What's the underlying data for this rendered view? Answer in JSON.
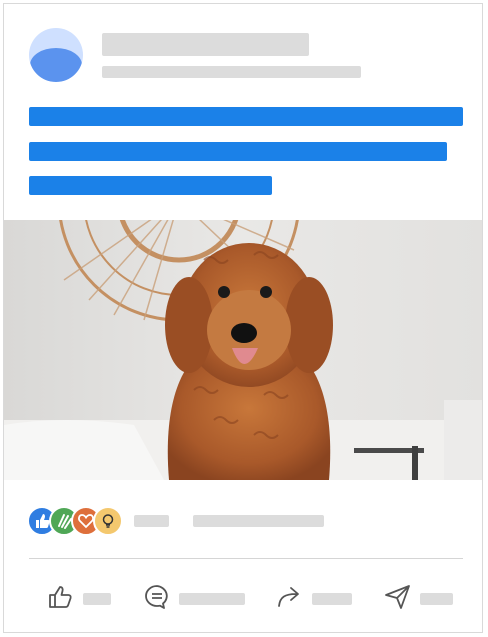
{
  "post": {
    "avatar_colors": {
      "bg": "#cfe0ff",
      "fg": "#5b93ee"
    },
    "skeleton_color": "#dcdcdc",
    "text_skeleton_color": "#1b81e8",
    "image_subject": "dog-photo"
  },
  "reactions": {
    "icons": [
      "like-icon",
      "clap-icon",
      "love-icon",
      "idea-icon"
    ]
  },
  "actions": [
    {
      "name": "like",
      "icon": "thumbs-up-icon"
    },
    {
      "name": "comment",
      "icon": "comment-icon"
    },
    {
      "name": "share",
      "icon": "share-arrow-icon"
    },
    {
      "name": "send",
      "icon": "send-icon"
    }
  ]
}
